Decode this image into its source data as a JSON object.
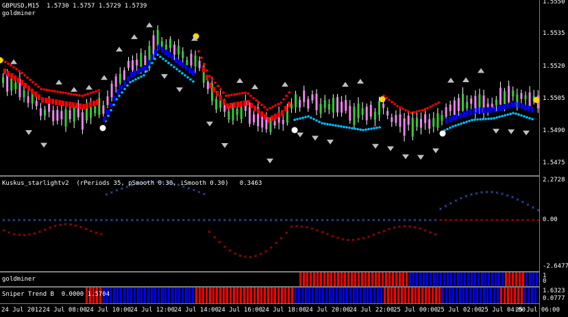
{
  "main": {
    "header": "GBPUSD,M15  1.5730 1.5757 1.5729 1.5739",
    "indicator": "goldminer",
    "price_ticks": [
      "1.5550",
      "1.5535",
      "1.5520",
      "1.5505",
      "1.5490",
      "1.5475"
    ]
  },
  "kuskus": {
    "header": "Kuskus_starlightv2  (rPeriods 35, pSmooth 0.30, iSmooth 0.30)   0.3463",
    "ticks": [
      "2.2728",
      "0.00",
      "-2.6477"
    ]
  },
  "goldminer_pane": {
    "header": "goldminer",
    "ticks": [
      "1",
      "0"
    ]
  },
  "sniper": {
    "header": "Sniper Trend B  0.0000 1.5704",
    "ticks": [
      "1.6323",
      "0.0777"
    ]
  },
  "time_axis": [
    "24 Jul 2012",
    "24 Jul 08:00",
    "24 Jul 10:00",
    "24 Jul 12:00",
    "24 Jul 14:00",
    "24 Jul 16:00",
    "24 Jul 18:00",
    "24 Jul 20:00",
    "24 Jul 22:00",
    "25 Jul 00:00",
    "25 Jul 02:00",
    "25 Jul 04:00",
    "25 Jul 06:00"
  ],
  "colors": {
    "bull": "#32cd32",
    "bear": "#ee82ee",
    "bear_trail": "#ff0000",
    "bull_trail": "#0000ff",
    "light_trail": "#00bfff",
    "sell_dot": "#ffd700",
    "buy_dot": "#ffffff",
    "kuskus_pos": "#4169e1",
    "kuskus_neg": "#ff0000"
  }
}
